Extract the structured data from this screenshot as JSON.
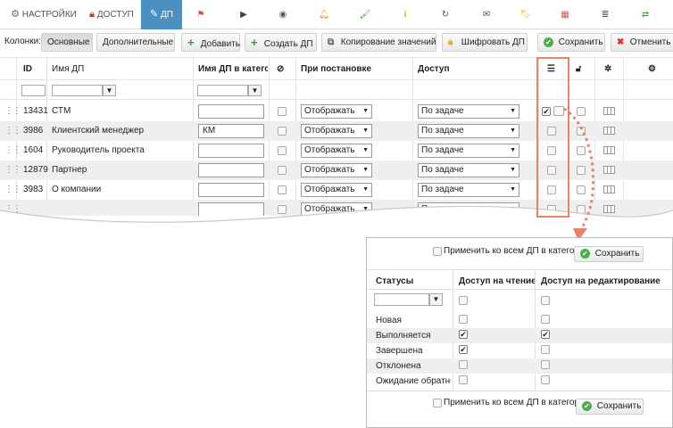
{
  "nav": {
    "settings": "НАСТРОЙКИ",
    "access": "ДОСТУП",
    "dp": "ДП"
  },
  "toolbar": {
    "columns_label": "Колонки:",
    "basic": "Основные",
    "additional": "Дополнительные",
    "add": "Добавить",
    "create_dp": "Создать ДП",
    "copy_values": "Копирование значений",
    "encrypt_dp": "Шифровать ДП",
    "save": "Сохранить",
    "cancel": "Отменить"
  },
  "grid": {
    "headers": {
      "id": "ID",
      "name": "Имя ДП",
      "category_name": "Имя ДП в катего",
      "on_setting": "При постановке",
      "access": "Доступ"
    },
    "rows": [
      {
        "id": "13431",
        "name": "СТМ",
        "cat": "",
        "on_setting": "Отображать",
        "access": "По задаче"
      },
      {
        "id": "3986",
        "name": "Клиентский менеджер",
        "cat": "КМ",
        "on_setting": "Отображать",
        "access": "По задаче"
      },
      {
        "id": "1604",
        "name": "Руководитель проекта",
        "cat": "",
        "on_setting": "Отображать",
        "access": "По задаче"
      },
      {
        "id": "12879",
        "name": "Партнер",
        "cat": "",
        "on_setting": "Отображать",
        "access": "По задаче"
      },
      {
        "id": "3983",
        "name": "О компании",
        "cat": "",
        "on_setting": "Отображать",
        "access": "По задаче"
      },
      {
        "id": "",
        "name": "",
        "cat": "",
        "on_setting": "Отображать",
        "access": "По задаче"
      }
    ]
  },
  "popup": {
    "apply_all": "Применить ко всем ДП в категории",
    "save": "Сохранить",
    "col_status": "Статусы",
    "col_read": "Доступ на чтение",
    "col_edit": "Доступ на редактирование",
    "statuses": [
      {
        "name": "Новая",
        "read": false,
        "edit": false
      },
      {
        "name": "Выполняется",
        "read": true,
        "edit": true
      },
      {
        "name": "Завершена",
        "read": true,
        "edit": false
      },
      {
        "name": "Отклонена",
        "read": false,
        "edit": false
      },
      {
        "name": "Ожидание обратной",
        "read": false,
        "edit": false
      }
    ]
  },
  "colors": {
    "accent": "#4a90c2",
    "highlight": "#e8826b",
    "save_green": "#4cae4c",
    "cancel_red": "#d9302c"
  }
}
